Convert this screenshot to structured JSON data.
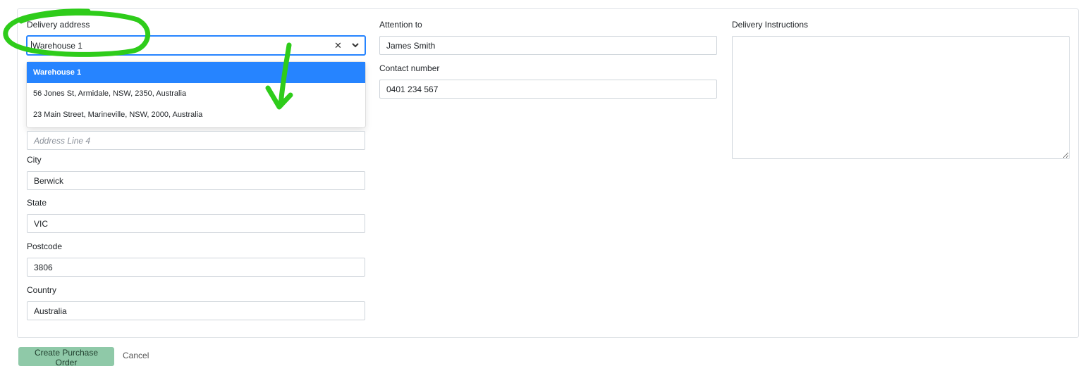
{
  "delivery": {
    "label": "Delivery address",
    "selected": "Warehouse 1",
    "clear_icon": "close-icon",
    "arrow_icon": "chevron-down-icon",
    "options": [
      "Warehouse 1",
      "56 Jones St, Armidale, NSW, 2350, Australia",
      "23 Main Street, Marineville, NSW, 2000, Australia"
    ],
    "active_option": 0
  },
  "address": {
    "line4_placeholder": "Address Line 4",
    "city_label": "City",
    "city": "Berwick",
    "state_label": "State",
    "state": "VIC",
    "postcode_label": "Postcode",
    "postcode": "3806",
    "country_label": "Country",
    "country": "Australia"
  },
  "contact": {
    "attention_label": "Attention to",
    "attention": "James Smith",
    "phone_label": "Contact number",
    "phone": "0401 234 567"
  },
  "instructions": {
    "label": "Delivery Instructions",
    "value": ""
  },
  "actions": {
    "create_label": "Create Purchase Order",
    "cancel_label": "Cancel"
  },
  "colors": {
    "focus": "#2684ff",
    "primary_button": "#8fc9a8",
    "annotation": "#2ecc1a"
  }
}
